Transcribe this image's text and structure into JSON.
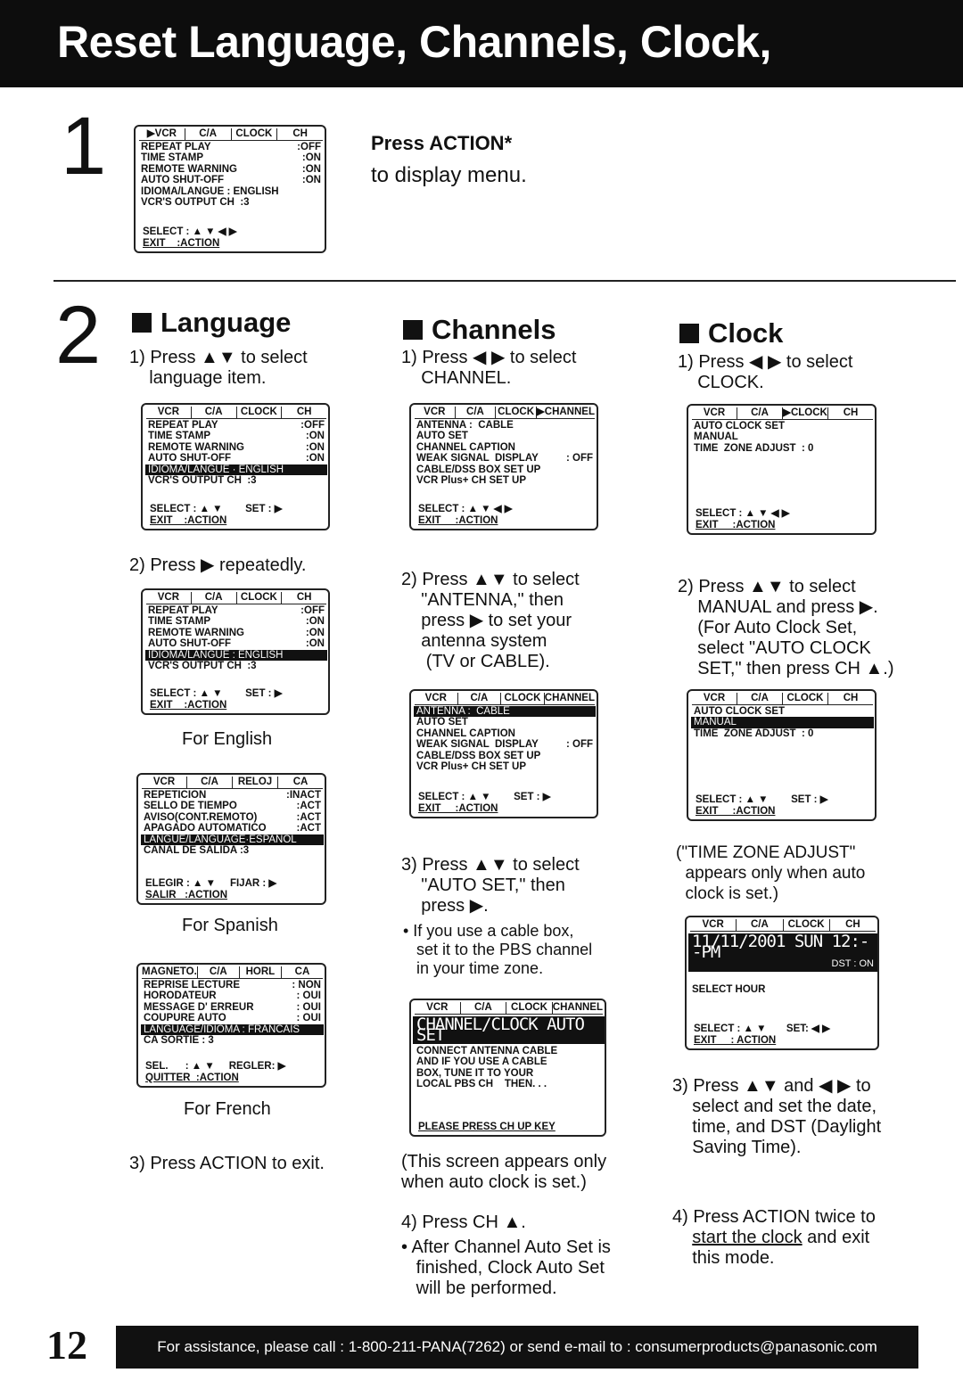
{
  "title": "Reset Language, Channels, Clock,",
  "step1": {
    "num": "1",
    "heading": "Press ACTION*",
    "text": "to display menu."
  },
  "step2": {
    "num": "2"
  },
  "screens": {
    "s1": {
      "tabs": [
        "▶VCR",
        "C/A",
        "CLOCK",
        "CH"
      ],
      "rows": [
        [
          "REPEAT PLAY",
          ":OFF"
        ],
        [
          "TIME STAMP",
          ":ON"
        ],
        [
          "REMOTE WARNING",
          ":ON"
        ],
        [
          "AUTO SHUT-OFF",
          ":ON"
        ],
        [
          "IDIOMA/LANGUE : ENGLISH",
          ""
        ],
        [
          "VCR'S OUTPUT CH  :3",
          ""
        ]
      ],
      "hl": -1,
      "foot": [
        "SELECT : ▲ ▼ ◀ ▶",
        "EXIT    :ACTION"
      ]
    },
    "lang1": {
      "tabs": [
        "VCR",
        "C/A",
        "CLOCK",
        "CH"
      ],
      "rows": [
        [
          "REPEAT PLAY",
          ":OFF"
        ],
        [
          "TIME STAMP",
          ":ON"
        ],
        [
          "REMOTE WARNING",
          ":ON"
        ],
        [
          "AUTO SHUT-OFF",
          ":ON"
        ],
        [
          "IDIOMA/LANGUE · ENGLISH",
          ""
        ],
        [
          "VCR'S OUTPUT CH  :3",
          ""
        ]
      ],
      "hl": 4,
      "foot": [
        "SELECT : ▲ ▼        SET : ▶",
        "EXIT    :ACTION"
      ]
    },
    "lang2": {
      "tabs": [
        "VCR",
        "C/A",
        "CLOCK",
        "CH"
      ],
      "rows": [
        [
          "REPEAT PLAY",
          ":OFF"
        ],
        [
          "TIME STAMP",
          ":ON"
        ],
        [
          "REMOTE WARNING",
          ":ON"
        ],
        [
          "AUTO SHUT-OFF",
          ":ON"
        ],
        [
          "IDIOMA/LANGUE : ENGLISH",
          ""
        ],
        [
          "VCR'S OUTPUT CH  :3",
          ""
        ]
      ],
      "hl": 4,
      "foot": [
        "SELECT : ▲ ▼        SET : ▶",
        "EXIT    :ACTION"
      ]
    },
    "lang_es": {
      "tabs": [
        "VCR",
        "C/A",
        "RELOJ",
        "CA"
      ],
      "rows": [
        [
          "REPETICION",
          ":INACT"
        ],
        [
          "SELLO DE TIEMPO",
          ":ACT"
        ],
        [
          "AVISO(CONT.REMOTO)",
          ":ACT"
        ],
        [
          "APAGADO AUTOMATICO",
          ":ACT"
        ],
        [
          "LANGUE/LANGUAGE·ESPANOL",
          ""
        ],
        [
          "CANAL DE SALIDA :3",
          ""
        ]
      ],
      "hl": 4,
      "foot": [
        "ELEGIR : ▲ ▼     FIJAR : ▶",
        "SALIR   :ACTION"
      ]
    },
    "lang_fr": {
      "tabs": [
        "MAGNETO.",
        "C/A",
        "HORL",
        "CA"
      ],
      "rows": [
        [
          "REPRISE LECTURE",
          ": NON"
        ],
        [
          "HORODATEUR",
          ": OUI"
        ],
        [
          "MESSAGE D' ERREUR",
          ": OUI"
        ],
        [
          "COUPURE AUTO",
          ": OUI"
        ],
        [
          "LANGUAGE/IDIOMA : FRANCAIS",
          ""
        ],
        [
          "CA SORTIE : 3",
          ""
        ]
      ],
      "hl": 4,
      "foot": [
        "SEL.      : ▲ ▼     REGLER: ▶",
        "QUITTER  :ACTION"
      ]
    },
    "ch1": {
      "tabs": [
        "VCR",
        "C/A",
        "CLOCK",
        "▶CHANNEL"
      ],
      "rows": [
        [
          "ANTENNA :  CABLE",
          ""
        ],
        [
          "AUTO SET",
          ""
        ],
        [
          "CHANNEL CAPTION",
          ""
        ],
        [
          "WEAK SIGNAL  DISPLAY",
          ": OFF"
        ],
        [
          "CABLE/DSS BOX SET UP",
          ""
        ],
        [
          "VCR Plus+ CH SET UP",
          ""
        ]
      ],
      "hl": -1,
      "foot": [
        "SELECT : ▲ ▼ ◀ ▶",
        "EXIT     :ACTION"
      ]
    },
    "ch2": {
      "tabs": [
        "VCR",
        "C/A",
        "CLOCK",
        "CHANNEL"
      ],
      "rows": [
        [
          "ANTENNA :  CABLE",
          ""
        ],
        [
          "AUTO SET",
          ""
        ],
        [
          "CHANNEL CAPTION",
          ""
        ],
        [
          "WEAK SIGNAL  DISPLAY",
          ": OFF"
        ],
        [
          "CABLE/DSS BOX SET UP",
          ""
        ],
        [
          "VCR Plus+ CH SET UP",
          ""
        ]
      ],
      "hl": 0,
      "foot": [
        "SELECT : ▲ ▼        SET : ▶",
        "EXIT     :ACTION"
      ]
    },
    "ch3": {
      "tabs": [
        "VCR",
        "C/A",
        "CLOCK",
        "CHANNEL"
      ],
      "big": "CHANNEL/CLOCK AUTO SET",
      "rows": [
        [
          "CONNECT ANTENNA CABLE",
          ""
        ],
        [
          "AND IF YOU USE A CABLE",
          ""
        ],
        [
          "BOX, TUNE IT TO YOUR",
          ""
        ],
        [
          "LOCAL PBS CH    THEN. . .",
          ""
        ]
      ],
      "hl": -1,
      "foot": [
        "",
        "PLEASE PRESS CH UP KEY"
      ]
    },
    "cl1": {
      "tabs": [
        "VCR",
        "C/A",
        "▶CLOCK",
        "CH"
      ],
      "rows": [
        [
          "AUTO CLOCK SET",
          ""
        ],
        [
          "MANUAL",
          ""
        ],
        [
          "TIME  ZONE ADJUST  : 0",
          ""
        ]
      ],
      "hl": -1,
      "foot": [
        "SELECT : ▲ ▼ ◀ ▶",
        "EXIT     :ACTION"
      ]
    },
    "cl2": {
      "tabs": [
        "VCR",
        "C/A",
        "CLOCK",
        "CH"
      ],
      "rows": [
        [
          "AUTO CLOCK SET",
          ""
        ],
        [
          "MANUAL",
          ""
        ],
        [
          "TIME  ZONE ADJUST  : 0",
          ""
        ]
      ],
      "hl": 1,
      "foot": [
        "SELECT : ▲ ▼        SET : ▶",
        "EXIT     :ACTION"
      ]
    },
    "cl3": {
      "tabs": [
        "VCR",
        "C/A",
        "CLOCK",
        "CH"
      ],
      "big": "11/11/2001 SUN 12:--PM",
      "big_sub": "DST : ON",
      "rows": [
        [
          "",
          ""
        ],
        [
          "SELECT HOUR",
          ""
        ]
      ],
      "hl": -1,
      "foot": [
        "SELECT : ▲ ▼       SET: ◀ ▶",
        "EXIT     : ACTION"
      ]
    }
  },
  "language": {
    "heading": "Language",
    "s1": "1) Press ▲▼ to select\n    language item.",
    "s2": "2) Press ▶ repeatedly.",
    "cap_en": "For English",
    "cap_es": "For Spanish",
    "cap_fr": "For French",
    "s3": "3) Press ACTION to exit."
  },
  "channels": {
    "heading": "Channels",
    "s1": "1) Press ◀ ▶ to select\n    CHANNEL.",
    "s2": "2) Press ▲▼ to select\n    \"ANTENNA,\" then\n    press ▶ to set your\n    antenna system\n     (TV or CABLE).",
    "s3": "3) Press ▲▼ to select\n    \"AUTO SET,\" then\n    press ▶.",
    "bullet1": "• If you use a cable box,\n   set it to the PBS channel\n   in your time zone.",
    "note": "(This screen appears only\nwhen auto clock is set.)",
    "s4": "4) Press CH ▲.",
    "bullet2": "• After Channel Auto Set is\n   finished, Clock Auto Set\n   will be performed."
  },
  "clock": {
    "heading": "Clock",
    "s1": "1) Press ◀ ▶ to select\n    CLOCK.",
    "s2": "2) Press ▲▼ to select\n    MANUAL and press ▶.\n    (For Auto Clock Set,\n    select \"AUTO CLOCK\n    SET,\" then press CH ▲.)",
    "note": "(\"TIME ZONE ADJUST\"\n  appears only when auto\n  clock is set.)",
    "s3": "3) Press ▲▼ and ◀ ▶ to\n    select and set the date,\n    time, and DST (Daylight\n    Saving Time).",
    "s4_pre": "4) Press ACTION twice to\n    ",
    "s4_link": "start the clock",
    "s4_post": " and exit\n    this mode."
  },
  "footer": {
    "page": "12",
    "text": "For assistance, please call : 1-800-211-PANA(7262) or send e-mail to : consumerproducts@panasonic.com"
  }
}
